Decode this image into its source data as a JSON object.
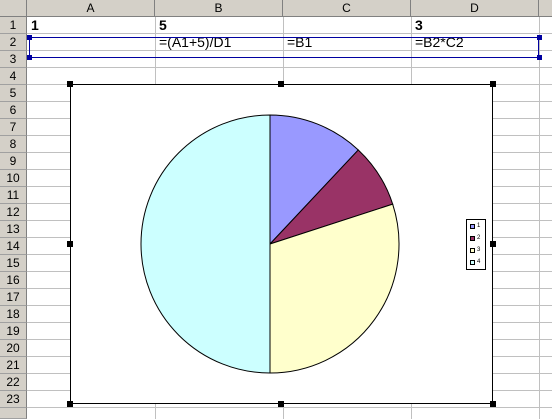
{
  "columns": [
    "A",
    "B",
    "C",
    "D"
  ],
  "rows": [
    "1",
    "2",
    "3",
    "4",
    "5",
    "6",
    "7",
    "8",
    "9",
    "10",
    "11",
    "12",
    "13",
    "14",
    "15",
    "16",
    "17",
    "18",
    "19",
    "20",
    "21",
    "22",
    "23"
  ],
  "cells": {
    "A1": "1",
    "B1": "5",
    "D1": "3",
    "B2": "=(A1+5)/D1",
    "C2": "=B1",
    "D2": "=B2*C2"
  },
  "chart_data": {
    "type": "pie",
    "categories": [
      "1",
      "2",
      "3",
      "4"
    ],
    "values": [
      1,
      0.667,
      2.5,
      4.167
    ],
    "title": "",
    "colors": [
      "#9999ff",
      "#993366",
      "#ffffcc",
      "#ccffff"
    ],
    "legend_position": "right"
  },
  "legend": {
    "items": [
      {
        "label": "1",
        "color": "#9999ff"
      },
      {
        "label": "2",
        "color": "#993366"
      },
      {
        "label": "3",
        "color": "#ffffcc"
      },
      {
        "label": "4",
        "color": "#ccffff"
      }
    ]
  }
}
